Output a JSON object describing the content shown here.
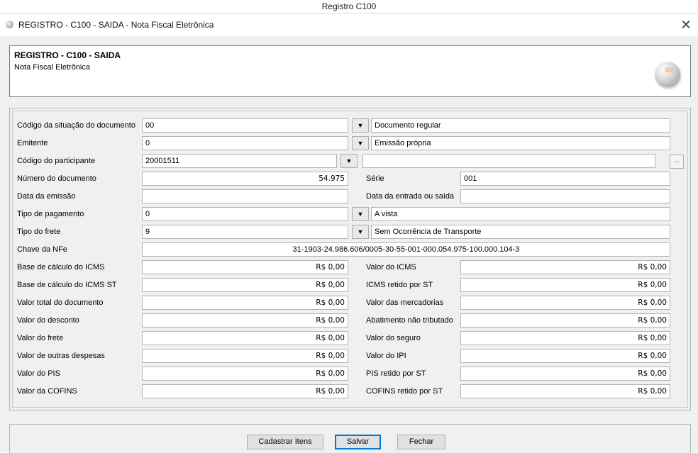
{
  "window": {
    "caption": "Registro C100",
    "title": "REGISTRO - C100 - SAIDA - Nota Fiscal Eletrônica",
    "close_glyph": "✕"
  },
  "header": {
    "title": "REGISTRO - C100 - SAIDA",
    "subtitle": "Nota Fiscal Eletrônica"
  },
  "icons": {
    "app": "gray-sphere-icon",
    "logo": "sphere-logo",
    "dropdown": "chevron-down-icon",
    "ellipsis": "ellipsis-icon"
  },
  "glyphs": {
    "dropdown": "▼",
    "ellipsis": "..."
  },
  "form": {
    "cod_situacao": {
      "label": "Código da situação do documento",
      "value": "00",
      "desc": "Documento regular"
    },
    "emitente": {
      "label": "Emitente",
      "value": "0",
      "desc": "Emissão própria"
    },
    "cod_participante": {
      "label": "Código do participante",
      "value": "20001511",
      "desc": ""
    },
    "num_doc": {
      "label": "Número do documento",
      "value": "54.975"
    },
    "serie": {
      "label": "Série",
      "value": "001"
    },
    "data_emissao": {
      "label": "Data da emissão",
      "value": ""
    },
    "data_entrada_saida": {
      "label": "Data da entrada ou saída",
      "value": ""
    },
    "tipo_pagamento": {
      "label": "Tipo de pagamento",
      "value": "0",
      "desc": "A vista"
    },
    "tipo_frete": {
      "label": "Tipo do frete",
      "value": "9",
      "desc": "Sem Ocorrência de Transporte"
    },
    "chave_nfe": {
      "label": "Chave da NFe",
      "value": "31-1903-24.986.606/0005-30-55-001-000.054.975-100.000.104-3"
    },
    "base_icms": {
      "label": "Base de cálculo do ICMS",
      "value": "R$ 0,00"
    },
    "valor_icms": {
      "label": "Valor do ICMS",
      "value": "R$ 0,00"
    },
    "base_icms_st": {
      "label": "Base de cálculo do ICMS ST",
      "value": "R$ 0,00"
    },
    "icms_retido_st": {
      "label": "ICMS retido por ST",
      "value": "R$ 0,00"
    },
    "valor_total_doc": {
      "label": "Valor total do documento",
      "value": "R$ 0,00"
    },
    "valor_mercadorias": {
      "label": "Valor das mercadorias",
      "value": "R$ 0,00"
    },
    "valor_desconto": {
      "label": "Valor do desconto",
      "value": "R$ 0,00"
    },
    "abatimento": {
      "label": "Abatimento não tributado",
      "value": "R$ 0,00"
    },
    "valor_frete": {
      "label": "Valor do frete",
      "value": "R$ 0,00"
    },
    "valor_seguro": {
      "label": "Valor do seguro",
      "value": "R$ 0,00"
    },
    "valor_outras": {
      "label": "Valor de outras despesas",
      "value": "R$ 0,00"
    },
    "valor_ipi": {
      "label": "Valor do IPI",
      "value": "R$ 0,00"
    },
    "valor_pis": {
      "label": "Valor do PIS",
      "value": "R$ 0,00"
    },
    "pis_retido_st": {
      "label": "PIS retido por ST",
      "value": "R$ 0,00"
    },
    "valor_cofins": {
      "label": "Valor da COFINS",
      "value": "R$ 0,00"
    },
    "cofins_retido_st": {
      "label": "COFINS retido por ST",
      "value": "R$ 0,00"
    }
  },
  "buttons": {
    "cadastrar_itens": "Cadastrar Itens",
    "salvar": "Salvar",
    "fechar": "Fechar"
  }
}
